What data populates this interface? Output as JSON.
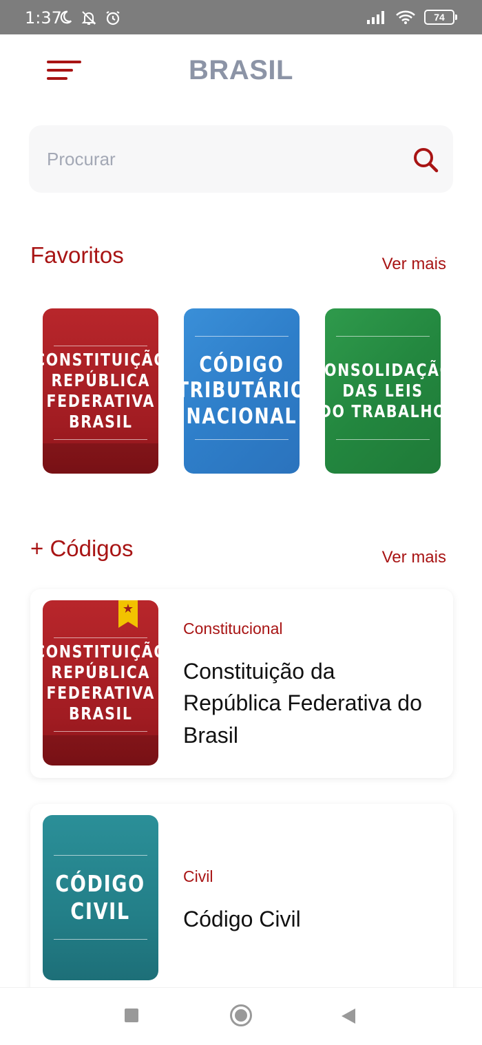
{
  "status_bar": {
    "time": "1:37",
    "battery": "74"
  },
  "header": {
    "title": "BRASIL"
  },
  "search": {
    "placeholder": "Procurar"
  },
  "favorites": {
    "title": "Favoritos",
    "see_more": "Ver mais",
    "items": [
      {
        "cover_lines": [
          "CONSTITUIÇÃO",
          "REPÚBLICA",
          "FEDERATIVA",
          "BRASIL"
        ],
        "color": "#b0232a"
      },
      {
        "cover_lines": [
          "CÓDIGO",
          "TRIBUTÁRIO",
          "NACIONAL"
        ],
        "color": "#3182cc"
      },
      {
        "cover_lines": [
          "CONSOLIDAÇÃO",
          "DAS LEIS",
          "DO TRABALHO"
        ],
        "color": "#258a42"
      }
    ]
  },
  "codes": {
    "title": "+ Códigos",
    "see_more": "Ver mais",
    "items": [
      {
        "category": "Constitucional",
        "title": "Constituição da República Federativa do Brasil",
        "cover_lines": [
          "CONSTITUIÇÃO",
          "REPÚBLICA",
          "FEDERATIVA",
          "BRASIL"
        ],
        "color": "#b0232a"
      },
      {
        "category": "Civil",
        "title": "Código Civil",
        "cover_lines": [
          "CÓDIGO",
          "CIVIL"
        ],
        "color": "#26838c"
      }
    ]
  },
  "colors": {
    "accent": "#a81414",
    "title_gray": "#8c94a6"
  }
}
